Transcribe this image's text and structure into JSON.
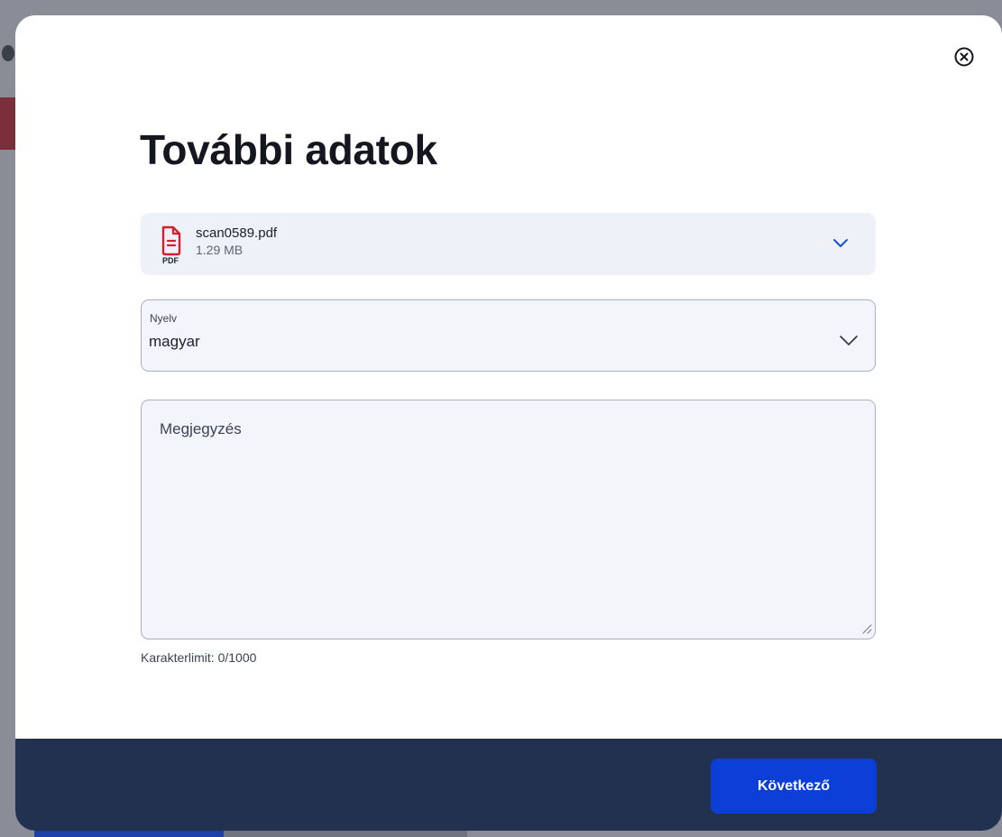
{
  "modal": {
    "title": "További adatok",
    "close_icon": "close-circle-icon"
  },
  "file": {
    "name": "scan0589.pdf",
    "size": "1.29 MB",
    "type_label": "PDF",
    "icon": "pdf-file-icon",
    "chevron": "chevron-down-icon",
    "icon_color": "#d4202c",
    "chevron_color": "#1c4ed8"
  },
  "language": {
    "label": "Nyelv",
    "value": "magyar",
    "chevron": "chevron-down-icon"
  },
  "note": {
    "placeholder": "Megjegyzés",
    "value": "",
    "char_limit": "Karakterlimit: 0/1000"
  },
  "footer": {
    "next_label": "Következő",
    "accent": "#0b3fd8",
    "background": "#233150"
  }
}
